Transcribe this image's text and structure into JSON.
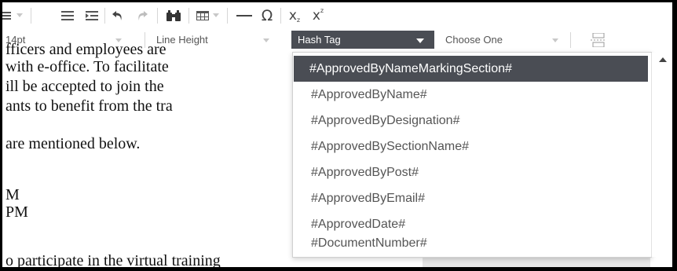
{
  "toolbar": {
    "icons": [
      "list-icon",
      "align-left-icon",
      "indent-icon",
      "undo-icon",
      "redo-icon",
      "find-replace-icon",
      "table-icon",
      "horizontal-rule-icon",
      "special-character-icon",
      "subscript-icon",
      "superscript-icon",
      "page-break-icon"
    ],
    "special_char": "Ω",
    "subscript_char": "x",
    "subscript_mark": "z",
    "superscript_char": "x",
    "superscript_mark": "z"
  },
  "format_bar": {
    "font_size": "14pt",
    "line_height": "Line Height",
    "hash_tag": "Hash Tag",
    "choose_one": "Choose One"
  },
  "document": {
    "lines": [
      "fficers and employees are",
      "with e-office. To facilitate",
      "ill be accepted to join the",
      "ants to benefit from the tra",
      "are mentioned below.",
      "M",
      "PM",
      "o participate in the virtual training"
    ]
  },
  "hashtag_menu": {
    "selected_index": 0,
    "items": [
      "#ApprovedByNameMarkingSection#",
      "#ApprovedByName#",
      "#ApprovedByDesignation#",
      "#ApprovedBySectionName#",
      "#ApprovedByPost#",
      "#ApprovedByEmail#",
      "#ApprovedDate#",
      "#DocumentNumber#"
    ]
  },
  "colors": {
    "selected_bg": "#4a4d54",
    "icon": "#555555",
    "caret": "#c8c8c8"
  }
}
